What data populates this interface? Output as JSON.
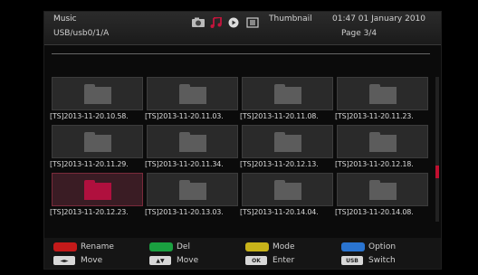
{
  "header": {
    "title": "Music",
    "path": "USB/usb0/1/A",
    "view_mode": "Thumbnail",
    "clock": "01:47 01 January 2010",
    "page_indicator": "Page 3/4",
    "media_icons": [
      "photo-icon",
      "music-icon",
      "play-icon",
      "video-icon"
    ]
  },
  "grid": {
    "selected_index": 8,
    "items": [
      {
        "label": "[TS]2013-11-20.10.58."
      },
      {
        "label": "[TS]2013-11-20.11.03."
      },
      {
        "label": "[TS]2013-11-20.11.08."
      },
      {
        "label": "[TS]2013-11-20.11.23."
      },
      {
        "label": "[TS]2013-11-20.11.29."
      },
      {
        "label": "[TS]2013-11-20.11.34."
      },
      {
        "label": "[TS]2013-11-20.12.13."
      },
      {
        "label": "[TS]2013-11-20.12.18."
      },
      {
        "label": "[TS]2013-11-20.12.23."
      },
      {
        "label": "[TS]2013-11-20.13.03."
      },
      {
        "label": "[TS]2013-11-20.14.04."
      },
      {
        "label": "[TS]2013-11-20.14.08."
      }
    ]
  },
  "footer": {
    "rename": "Rename",
    "del": "Del",
    "mode": "Mode",
    "option": "Option",
    "move1": "Move",
    "move2": "Move",
    "enter": "Enter",
    "switch": "Switch",
    "key_ok": "OK",
    "key_usb": "USB",
    "key_lr": "◄►",
    "key_ud": "▲▼"
  },
  "colors": {
    "red": "#c41a1a",
    "green": "#1aa040",
    "yellow": "#c8b31a",
    "blue": "#2a74d0",
    "selected_folder": "#b0103e"
  }
}
